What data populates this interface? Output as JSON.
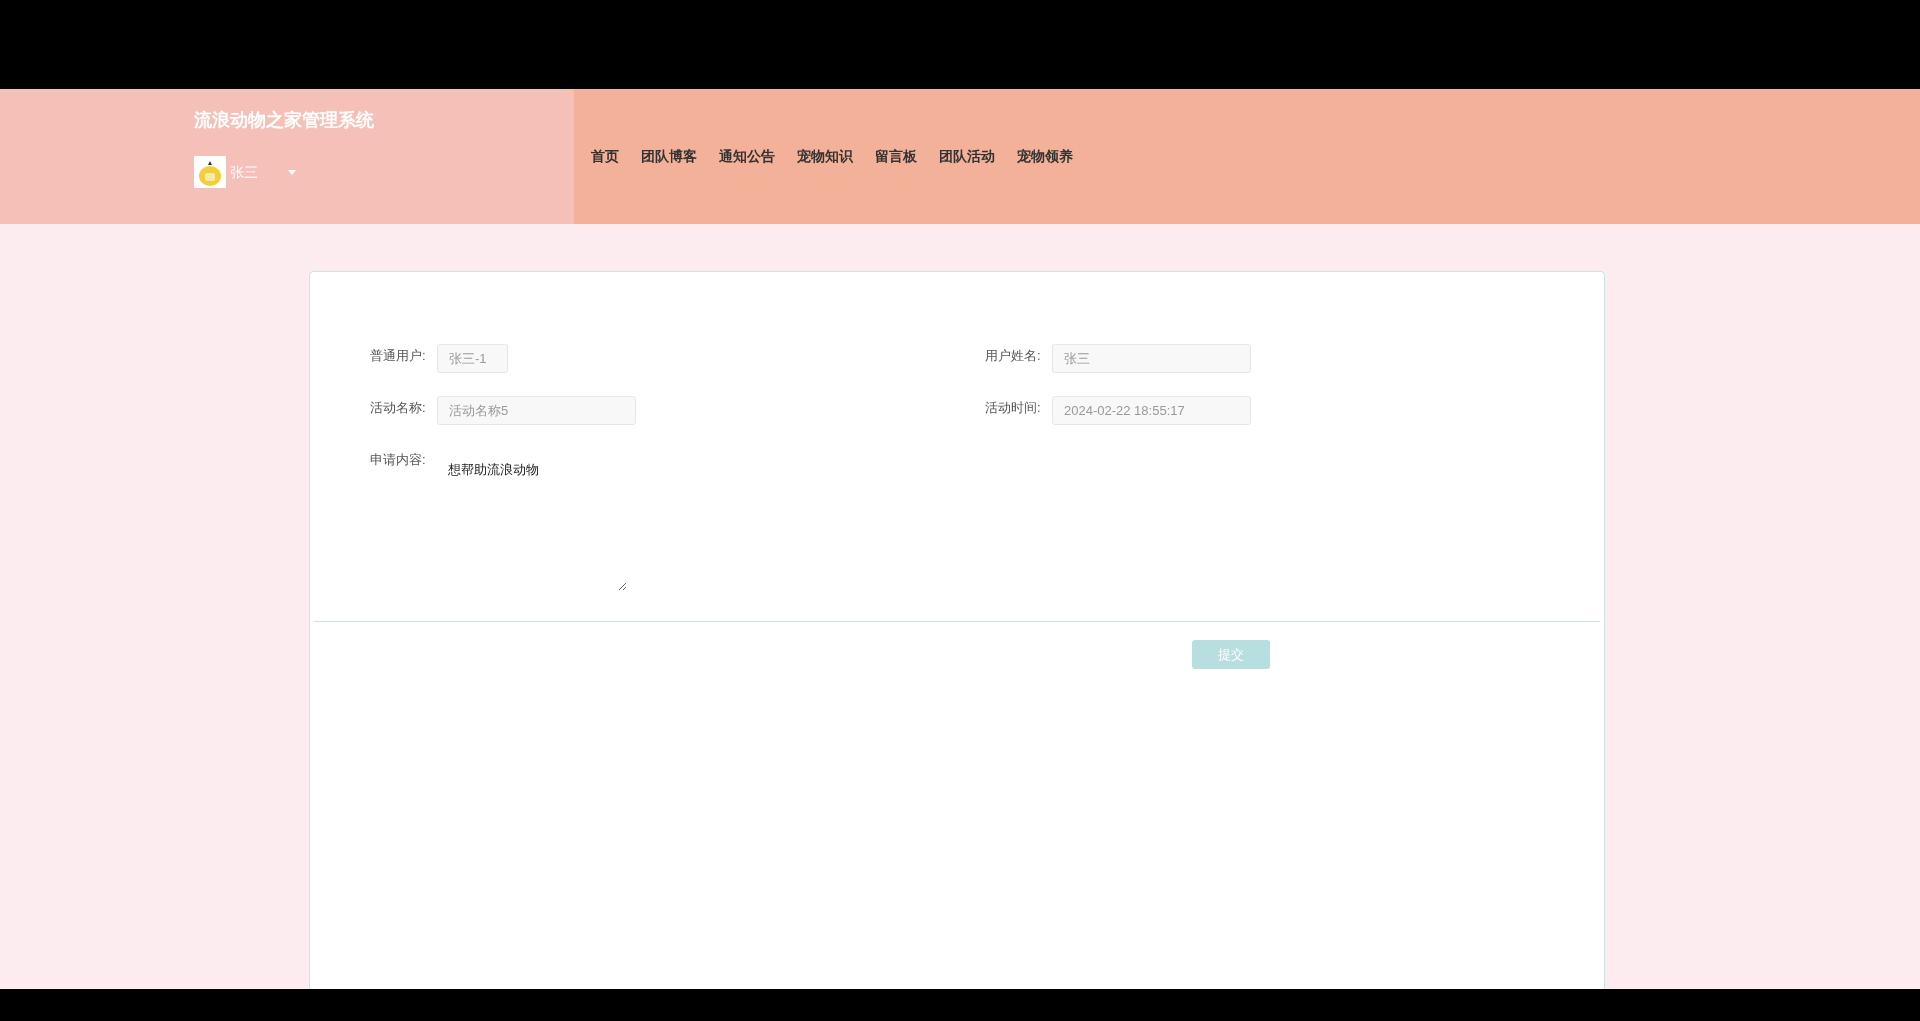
{
  "header": {
    "title": "流浪动物之家管理系统",
    "user": {
      "name": "张三"
    },
    "nav": [
      {
        "label": "首页"
      },
      {
        "label": "团队博客"
      },
      {
        "label": "通知公告"
      },
      {
        "label": "宠物知识"
      },
      {
        "label": "留言板"
      },
      {
        "label": "团队活动"
      },
      {
        "label": "宠物领养"
      }
    ]
  },
  "form": {
    "fields": [
      {
        "kind": "short",
        "label": "普通用户:",
        "value": "张三-1",
        "disabled": true
      },
      {
        "kind": "input",
        "label": "用户姓名:",
        "value": "张三",
        "disabled": true
      },
      {
        "kind": "input",
        "label": "活动名称:",
        "value": "活动名称5",
        "disabled": true
      },
      {
        "kind": "input",
        "label": "活动时间:",
        "value": "2024-02-22 18:55:17",
        "disabled": true
      },
      {
        "kind": "textarea",
        "label": "申请内容:",
        "value": "想帮助流浪动物",
        "disabled": false
      }
    ],
    "submit": "提交"
  }
}
